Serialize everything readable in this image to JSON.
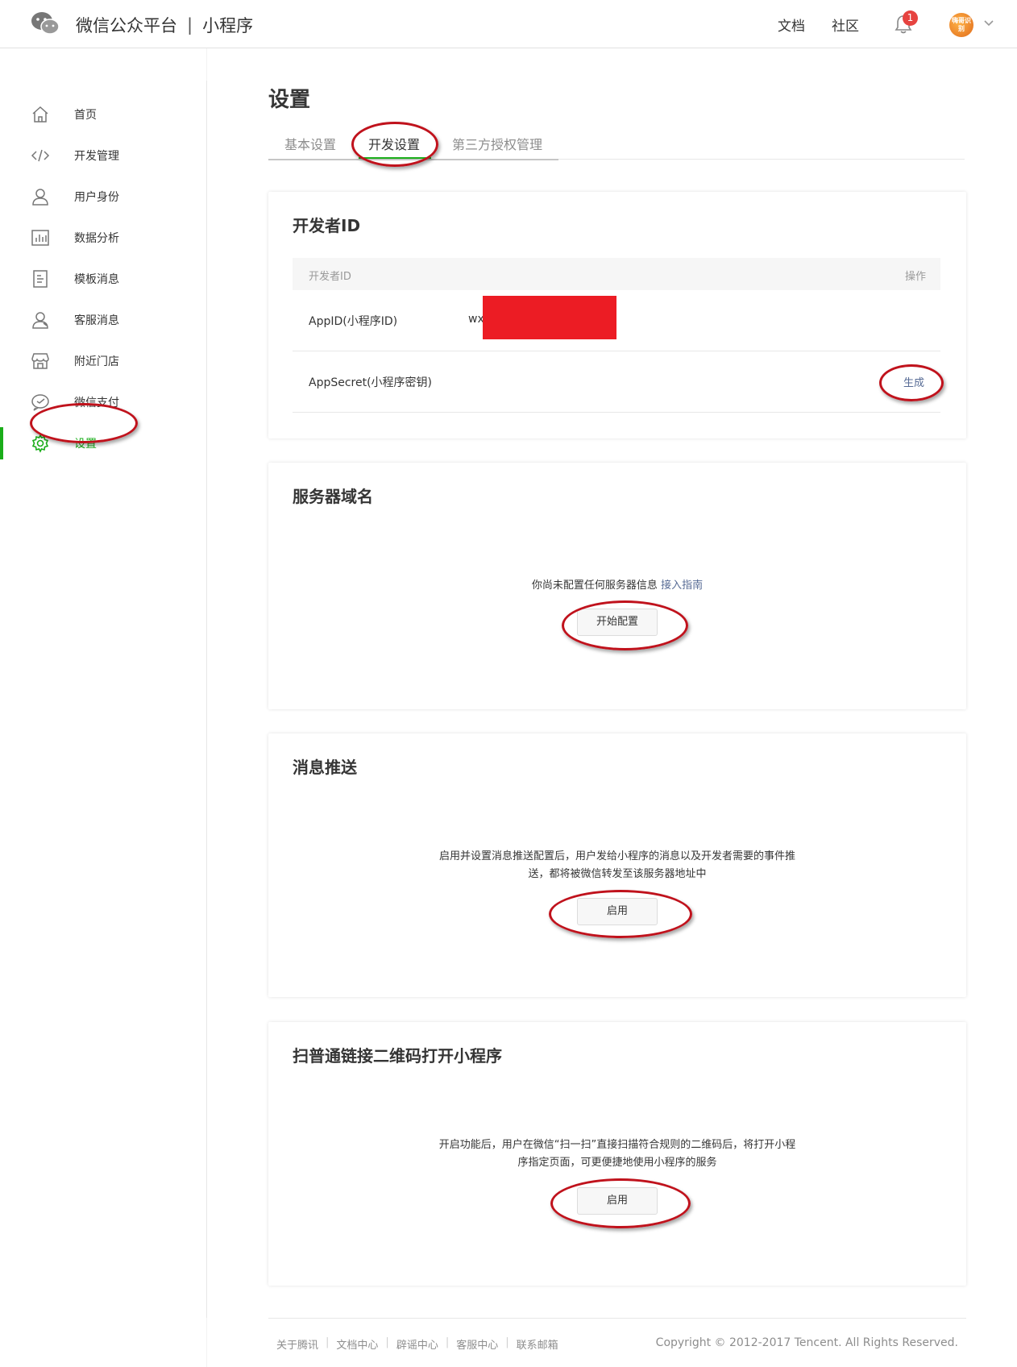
{
  "header": {
    "brand_main": "微信公众平台",
    "brand_sep": "|",
    "brand_sub": "小程序",
    "links": [
      "文档",
      "社区"
    ],
    "notification_count": "1",
    "avatar_text": "嗨哥识别"
  },
  "sidebar": {
    "items": [
      {
        "label": "首页",
        "icon": "home-icon"
      },
      {
        "label": "开发管理",
        "icon": "code-icon"
      },
      {
        "label": "用户身份",
        "icon": "user-icon"
      },
      {
        "label": "数据分析",
        "icon": "chart-icon"
      },
      {
        "label": "模板消息",
        "icon": "document-icon"
      },
      {
        "label": "客服消息",
        "icon": "customer-service-icon"
      },
      {
        "label": "附近门店",
        "icon": "store-icon"
      },
      {
        "label": "微信支付",
        "icon": "wechat-pay-icon"
      },
      {
        "label": "设置",
        "icon": "gear-icon",
        "active": true
      }
    ],
    "active_color": "#1aad19"
  },
  "page": {
    "title": "设置",
    "tabs": [
      "基本设置",
      "开发设置",
      "第三方授权管理"
    ],
    "active_tab": "开发设置"
  },
  "developer_id": {
    "title": "开发者ID",
    "col_id": "开发者ID",
    "col_op": "操作",
    "rows": [
      {
        "label": "AppID(小程序ID)",
        "value": "wx"
      },
      {
        "label": "AppSecret(小程序密钥)",
        "value": "",
        "action": "生成"
      }
    ]
  },
  "server_domain": {
    "title": "服务器域名",
    "message": "你尚未配置任何服务器信息",
    "guide_link": "接入指南",
    "button": "开始配置"
  },
  "message_push": {
    "title": "消息推送",
    "line1": "启用并设置消息推送配置后，用户发给小程序的消息以及开发者需要的事件推",
    "line2": "送，都将被微信转发至该服务器地址中",
    "button": "启用"
  },
  "qrcode": {
    "title": "扫普通链接二维码打开小程序",
    "line1": "开启功能后，用户在微信“扫一扫”直接扫描符合规则的二维码后，将打开小程",
    "line2": "序指定页面，可更便捷地使用小程序的服务",
    "button": "启用"
  },
  "footer": {
    "links": [
      "关于腾讯",
      "文档中心",
      "辟谣中心",
      "客服中心",
      "联系邮箱"
    ],
    "copyright": "Copyright © 2012-2017 Tencent. All Rights Reserved."
  },
  "colors": {
    "annotation_oval": "#c0121c",
    "redaction": "#ec1c24",
    "link": "#576b95"
  }
}
